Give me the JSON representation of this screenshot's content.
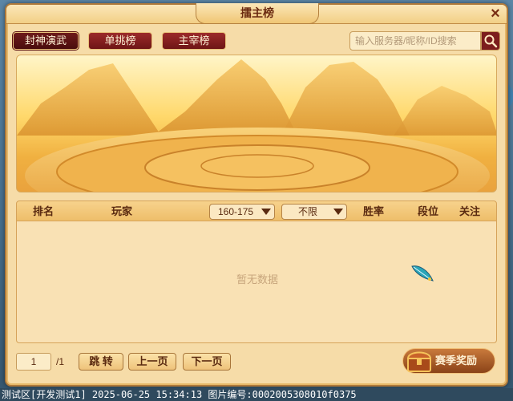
{
  "window": {
    "title": "擂主榜",
    "close_icon": "×"
  },
  "tabs": [
    {
      "label": "封神演武",
      "active": true
    },
    {
      "label": "单挑榜",
      "active": false
    },
    {
      "label": "主宰榜",
      "active": false
    }
  ],
  "search": {
    "placeholder": "输入服务器/昵称/ID搜索",
    "icon": "search-icon"
  },
  "table": {
    "headers": {
      "rank": "排名",
      "player": "玩家",
      "win_rate": "胜率",
      "tier": "段位",
      "follow": "关注"
    },
    "level_filter": "160-175",
    "type_filter": "不限",
    "empty_text": "暂无数据"
  },
  "pagination": {
    "current": "1",
    "total": "/1",
    "jump_label": "跳 转",
    "prev_label": "上一页",
    "next_label": "下一页"
  },
  "reward_button": {
    "label": "赛季奖励",
    "icon": "treasure-chest-icon"
  },
  "status_bar": {
    "text": "测试区[开发测试1] 2025-06-25 15:34:13 图片编号:0002005308010f0375"
  },
  "colors": {
    "panel_bg": "#f6dca8",
    "tab_red": "#7c1d1d",
    "text_brown": "#5a2a10"
  }
}
